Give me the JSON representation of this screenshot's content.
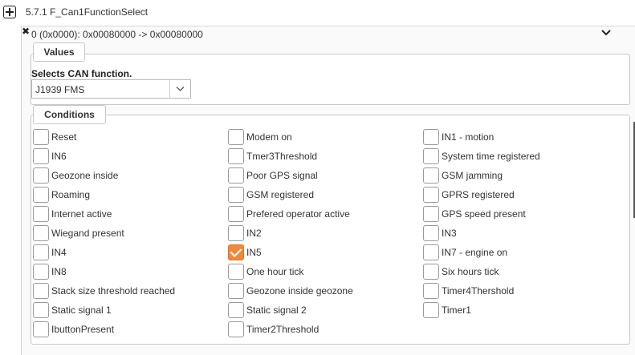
{
  "section": {
    "title": "5.7.1 F_Can1FunctionSelect"
  },
  "entry": {
    "text": "0 (0x0000): 0x00080000 -> 0x00080000"
  },
  "values": {
    "legend": "Values",
    "label": "Selects CAN function.",
    "selected": "J1939 FMS"
  },
  "conditions": {
    "legend": "Conditions",
    "items": [
      {
        "label": "Reset",
        "checked": false
      },
      {
        "label": "Modem on",
        "checked": false
      },
      {
        "label": "IN1 - motion",
        "checked": false
      },
      {
        "label": "IN6",
        "checked": false
      },
      {
        "label": "Tmer3Threshold",
        "checked": false
      },
      {
        "label": "System time registered",
        "checked": false
      },
      {
        "label": "Geozone inside",
        "checked": false
      },
      {
        "label": "Poor GPS signal",
        "checked": false
      },
      {
        "label": "GSM jamming",
        "checked": false
      },
      {
        "label": "Roaming",
        "checked": false
      },
      {
        "label": "GSM registered",
        "checked": false
      },
      {
        "label": "GPRS registered",
        "checked": false
      },
      {
        "label": "Internet active",
        "checked": false
      },
      {
        "label": "Prefered operator active",
        "checked": false
      },
      {
        "label": "GPS speed present",
        "checked": false
      },
      {
        "label": "Wiegand present",
        "checked": false
      },
      {
        "label": "IN2",
        "checked": false
      },
      {
        "label": "IN3",
        "checked": false
      },
      {
        "label": "IN4",
        "checked": false
      },
      {
        "label": "IN5",
        "checked": true
      },
      {
        "label": "IN7 - engine on",
        "checked": false
      },
      {
        "label": "IN8",
        "checked": false
      },
      {
        "label": "One hour tick",
        "checked": false
      },
      {
        "label": "Six hours tick",
        "checked": false
      },
      {
        "label": "Stack size threshold reached",
        "checked": false
      },
      {
        "label": "Geozone inside geozone",
        "checked": false
      },
      {
        "label": "Timer4Thershold",
        "checked": false
      },
      {
        "label": "Static signal 1",
        "checked": false
      },
      {
        "label": "Static signal 2",
        "checked": false
      },
      {
        "label": "Timer1",
        "checked": false
      },
      {
        "label": "IbuttonPresent",
        "checked": false
      },
      {
        "label": "Timer2Threshold",
        "checked": false
      }
    ]
  },
  "colors": {
    "checked_accent": "#f0883e"
  }
}
